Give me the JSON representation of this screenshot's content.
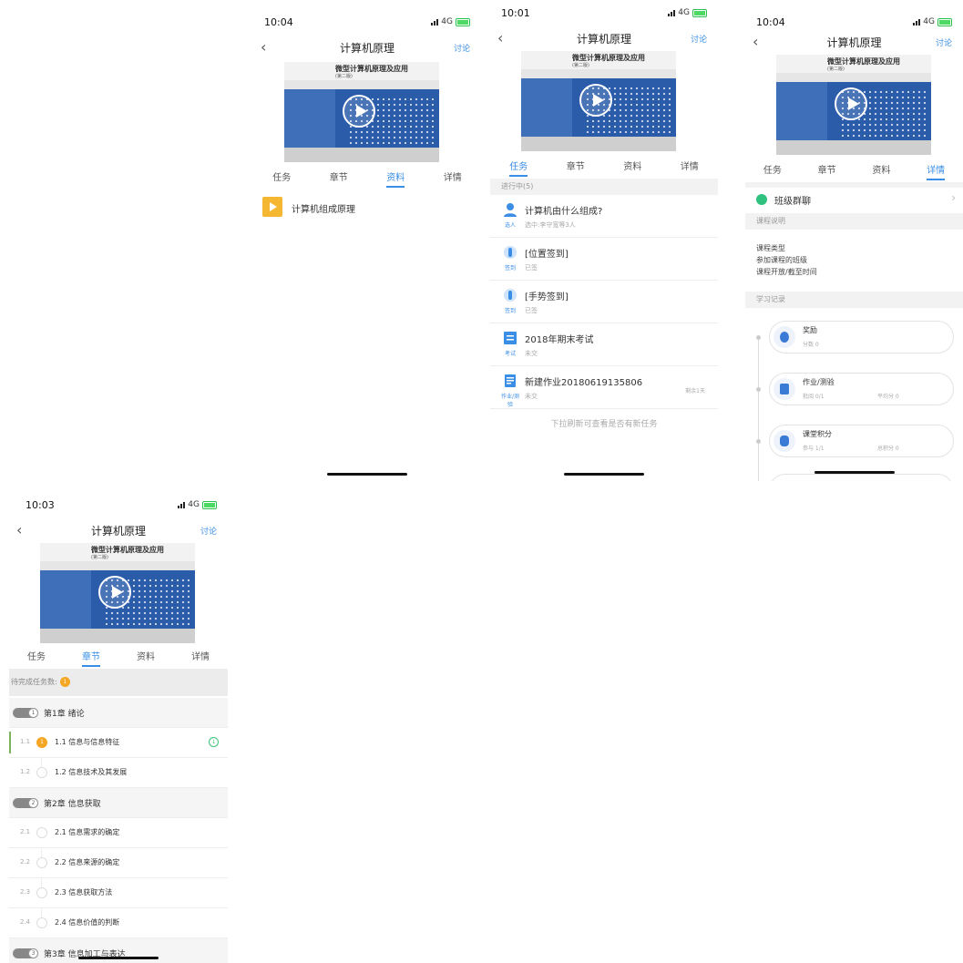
{
  "course_title": "计算机原理",
  "discuss_label": "讨论",
  "book_title": "微型计算机原理及应用",
  "book_edition": "(第二版)",
  "tabs": [
    "任务",
    "章节",
    "资料",
    "详情"
  ],
  "screens": {
    "resources": {
      "time": "10:04",
      "network": "4G",
      "items": [
        {
          "name": "计算机组成原理"
        }
      ]
    },
    "tasks": {
      "time": "10:01",
      "network": "4G",
      "section_header": "进行中(5)",
      "items": [
        {
          "type": "选人",
          "name": "计算机由什么组成?",
          "sub": "选中:李守宽等3人",
          "right": ""
        },
        {
          "type": "签到",
          "name": "[位置签到]",
          "sub": "已签",
          "right": ""
        },
        {
          "type": "签到",
          "name": "[手势签到]",
          "sub": "已签",
          "right": ""
        },
        {
          "type": "考试",
          "name": "2018年期末考试",
          "sub": "未交",
          "right": ""
        },
        {
          "type": "作业/测验",
          "name": "新建作业20180619135806",
          "sub": "未交",
          "right": "剩余1天"
        }
      ],
      "pull_hint": "下拉刷新可查看是否有新任务"
    },
    "details": {
      "time": "10:04",
      "network": "4G",
      "group_chat": "班级群聊",
      "course_desc_header": "课程说明",
      "desc_lines": [
        "课程类型",
        "参加课程的班级",
        "课程开放/截至时间"
      ],
      "study_record_header": "学习记录",
      "records": [
        {
          "title": "奖励",
          "sub1": "分数 0",
          "sub2": ""
        },
        {
          "title": "作业/测验",
          "sub1": "批阅 0/1",
          "sub2": "平均分 0"
        },
        {
          "title": "课堂积分",
          "sub1": "参与 1/1",
          "sub2": "总积分 0"
        }
      ]
    },
    "chapters": {
      "time": "10:03",
      "network": "4G",
      "pending_label": "待完成任务数:",
      "pending_count": "1",
      "chapters": [
        {
          "num": "1",
          "title": "第1章 绪论",
          "sections": [
            {
              "num": "1.1",
              "title": "1.1 信息与信息特征",
              "badge": "1",
              "download": "↓"
            },
            {
              "num": "1.2",
              "title": "1.2 信息技术及其发展",
              "badge": "",
              "download": ""
            }
          ]
        },
        {
          "num": "2",
          "title": "第2章 信息获取",
          "sections": [
            {
              "num": "2.1",
              "title": "2.1 信息需求的确定",
              "badge": "",
              "download": ""
            },
            {
              "num": "2.2",
              "title": "2.2 信息来源的确定",
              "badge": "",
              "download": ""
            },
            {
              "num": "2.3",
              "title": "2.3 信息获取方法",
              "badge": "",
              "download": ""
            },
            {
              "num": "2.4",
              "title": "2.4 信息价值的判断",
              "badge": "",
              "download": ""
            }
          ]
        },
        {
          "num": "3",
          "title": "第3章 信息加工与表达",
          "sections": []
        }
      ]
    }
  },
  "colors": {
    "accent": "#3a8ee6",
    "badge": "#f5a623",
    "chat_green": "#2ec27e"
  }
}
